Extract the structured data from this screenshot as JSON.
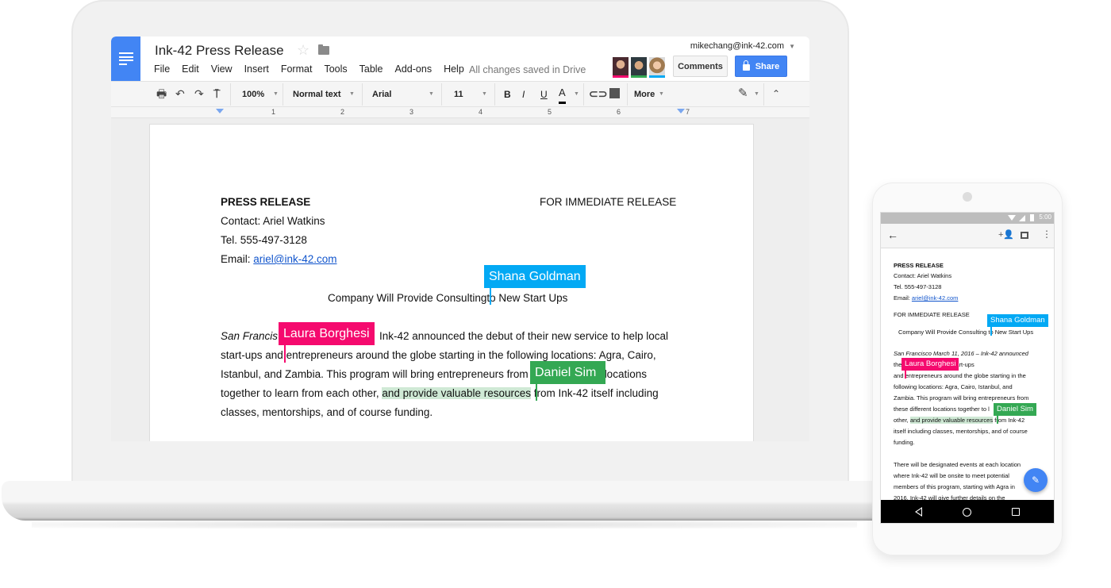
{
  "colors": {
    "docs_blue": "#4285f4",
    "shana": "#03a9f4",
    "laura": "#f50a6e",
    "daniel": "#34a853",
    "highlight": "#cfe9d5",
    "link": "#1155cc"
  },
  "docs": {
    "title": "Ink-42 Press Release",
    "menu": [
      "File",
      "Edit",
      "View",
      "Insert",
      "Format",
      "Tools",
      "Table",
      "Add-ons",
      "Help"
    ],
    "save_status": "All changes saved in Drive",
    "account": "mikechang@ink-42.com",
    "comments_label": "Comments",
    "share_label": "Share",
    "collaborators": [
      {
        "name": "Laura Borghesi",
        "color": "#f50a6e"
      },
      {
        "name": "Daniel Sim",
        "color": "#34a853"
      },
      {
        "name": "Shana Goldman",
        "color": "#03a9f4"
      }
    ],
    "toolbar": {
      "zoom": "100%",
      "style": "Normal text",
      "font": "Arial",
      "size": "11",
      "bold": "B",
      "italic": "I",
      "underline": "U",
      "text_color": "A",
      "more": "More"
    },
    "ruler": [
      "1",
      "2",
      "3",
      "4",
      "5",
      "6",
      "7"
    ]
  },
  "document": {
    "heading": "PRESS RELEASE",
    "release_note": "FOR IMMEDIATE RELEASE",
    "contact": "Contact: Ariel Watkins",
    "tel": "Tel. 555-497-3128",
    "email_label": "Email: ",
    "email": "ariel@ink-42.com",
    "subtitle_a": "Company Will Provide Consulting",
    "subtitle_b": "to New Start Ups",
    "body": {
      "l1a": "San Francis",
      "l1b": "Ink-42 announced the debut of their new service to help local",
      "l2a": "start-ups and",
      "l2b": "entrepreneurs around the globe starting in the following locations: Agra, Cairo,",
      "l3a": "Istanbul, and Zambia. This program will bring entrepreneurs from",
      "l3b": "locations",
      "l4a": "together to learn from each other, ",
      "l4hl": "and provide valuable resources",
      "l4b": "from Ink-42 itself including",
      "l5": "classes, mentorships, and of course funding."
    },
    "flags": {
      "shana": "Shana Goldman",
      "laura": "Laura Borghesi",
      "daniel": "Daniel Sim"
    }
  },
  "phone": {
    "time": "5:00",
    "lines": {
      "heading": "PRESS RELEASE",
      "contact": "Contact: Ariel Watkins",
      "tel": "Tel. 555-497-3128",
      "email_label": "Email: ",
      "email": "ariel@ink-42.com",
      "release_note": "FOR IMMEDIATE RELEASE",
      "subtitle": "Company Will Provide Consulting to New Start Ups",
      "p1": "San Francisco March 11, 2016 – Ink-42 announced",
      "p2": "the                              rvice to help local start-ups",
      "p3": "and entrepreneurs around the globe starting in the",
      "p4": "following locations: Agra, Cairo, Istanbul, and",
      "p5": "Zambia. This program will bring entrepreneurs from",
      "p6": "these different locations together to l",
      "p7a": "other, ",
      "p7hl": "and provide valuable resources",
      "p7b": "from Ink-42",
      "p8": "itself including classes, mentorships, and of course",
      "p9": "funding.",
      "q1": "There will be designated events at each location",
      "q2": "where Ink-42 will be onsite to meet potential",
      "q3": "members of this program, starting with Agra in",
      "q4": "2016. Ink-42 will give further details on the"
    },
    "flags": {
      "shana": "Shana Goldman",
      "laura": "Laura Borghesi",
      "daniel": "Daniel Sim"
    }
  }
}
